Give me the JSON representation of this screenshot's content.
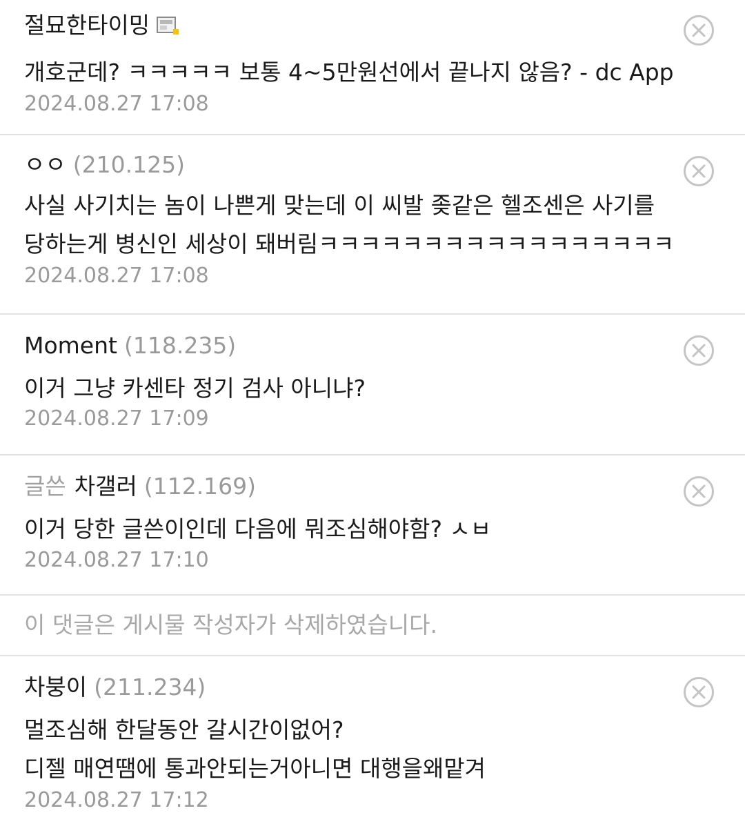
{
  "comments": [
    {
      "nick": "절묘한타이밍",
      "ip": "",
      "icon": "gallery-nickname-icon",
      "lines": [
        "개호군데? ㅋㅋㅋㅋㅋ 보통 4~5만원선에서 끝나지 않음? - dc App"
      ],
      "date": "2024.08.27 17:08"
    },
    {
      "nick": "ㅇㅇ",
      "ip": "(210.125)",
      "lines": [
        "사실 사기치는 놈이 나쁜게 맞는데 이 씨발 좆같은 헬조센은 사기를",
        "당하는게 병신인 세상이 돼버림ㅋㅋㅋㅋㅋㅋㅋㅋㅋㅋㅋㅋㅋㅋㅋㅋㅋ"
      ],
      "date": "2024.08.27 17:08"
    },
    {
      "nick": "Moment",
      "ip": "(118.235)",
      "lines": [
        "이거 그냥 카센타 정기 검사 아니냐?"
      ],
      "date": "2024.08.27 17:09"
    },
    {
      "badge": "글쓴",
      "nick": "차갤러",
      "ip": "(112.169)",
      "lines": [
        "이거 당한 글쓴이인데 다음에 뭐조심해야함? ㅅㅂ"
      ],
      "date": "2024.08.27 17:10"
    },
    {
      "nick": "차붕이",
      "ip": "(211.234)",
      "lines": [
        "멀조심해 한달동안 갈시간이없어?",
        "디젤 매연땜에 통과안되는거아니면 대행을왜맡겨"
      ],
      "date": "2024.08.27 17:12"
    }
  ],
  "deleted_notice": "이 댓글은 게시물 작성자가 삭제하였습니다.",
  "icons": {
    "delete": "close-circle-icon"
  },
  "colors": {
    "text": "#1a1a1a",
    "muted": "#9a9a9a",
    "divider": "#e2e2e2",
    "icon": "#c4c4c4"
  }
}
